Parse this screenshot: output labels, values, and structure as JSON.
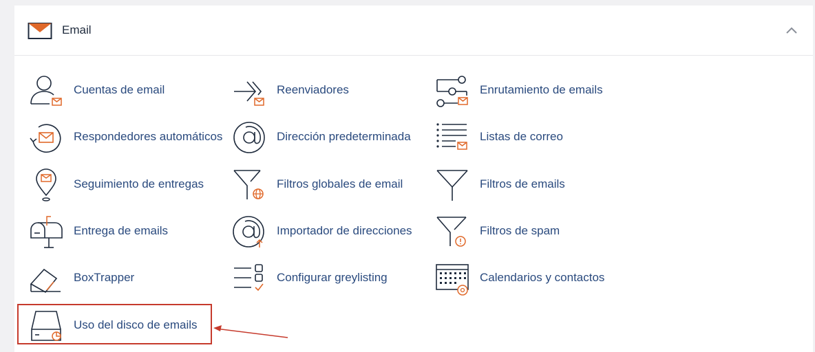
{
  "section": {
    "title": "Email",
    "icon": "envelope-icon",
    "accent_color": "#e0692a",
    "link_color": "#2a4a7e"
  },
  "items": [
    {
      "label": "Cuentas de email",
      "icon": "email-accounts-icon"
    },
    {
      "label": "Reenviadores",
      "icon": "forwarders-icon"
    },
    {
      "label": "Enrutamiento de emails",
      "icon": "email-routing-icon"
    },
    {
      "label": "Respondedores automáticos",
      "icon": "autoresponders-icon"
    },
    {
      "label": "Dirección predeterminada",
      "icon": "default-address-icon"
    },
    {
      "label": "Listas de correo",
      "icon": "mailing-lists-icon"
    },
    {
      "label": "Seguimiento de entregas",
      "icon": "track-delivery-icon"
    },
    {
      "label": "Filtros globales de email",
      "icon": "global-filters-icon"
    },
    {
      "label": "Filtros de emails",
      "icon": "email-filters-icon"
    },
    {
      "label": "Entrega de emails",
      "icon": "email-deliverability-icon"
    },
    {
      "label": "Importador de direcciones",
      "icon": "address-importer-icon"
    },
    {
      "label": "Filtros de spam",
      "icon": "spam-filters-icon"
    },
    {
      "label": "BoxTrapper",
      "icon": "boxtrapper-icon"
    },
    {
      "label": "Configurar greylisting",
      "icon": "greylisting-icon"
    },
    {
      "label": "Calendarios y contactos",
      "icon": "calendars-contacts-icon"
    },
    {
      "label": "Uso del disco de emails",
      "icon": "email-disk-usage-icon"
    }
  ],
  "annotation": {
    "highlighted_item": "Uso del disco de emails",
    "color": "#c63a2c"
  }
}
